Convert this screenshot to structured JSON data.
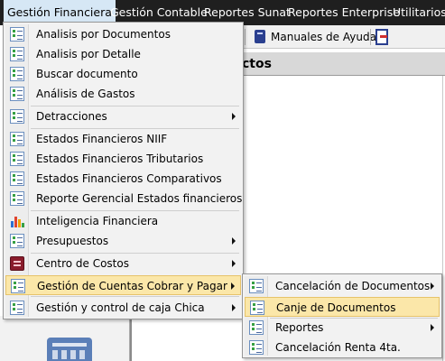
{
  "menubar": {
    "items": [
      "Gestión Financiera",
      "Gestión Contable",
      "Reportes Sunat",
      "Reportes Enterprise",
      "Utilitarios"
    ]
  },
  "toolbar": {
    "manuales_label": "Manuales de Ayuda"
  },
  "panel": {
    "header_fragment": "ctos"
  },
  "main_menu": {
    "items": [
      {
        "label": "Analisis por Documentos",
        "icon": "form-icon",
        "submenu": false
      },
      {
        "label": "Analisis por Detalle",
        "icon": "form-icon",
        "submenu": false
      },
      {
        "label": "Buscar documento",
        "icon": "form-icon",
        "submenu": false
      },
      {
        "label": "Análisis de Gastos",
        "icon": "form-icon",
        "submenu": false
      },
      {
        "label": "Detracciones",
        "icon": "form-icon",
        "submenu": true
      },
      {
        "label": "Estados Financieros NIIF",
        "icon": "form-icon",
        "submenu": false
      },
      {
        "label": "Estados Financieros Tributarios",
        "icon": "form-icon",
        "submenu": false
      },
      {
        "label": "Estados Financieros Comparativos",
        "icon": "form-icon",
        "submenu": false
      },
      {
        "label": "Reporte Gerencial Estados financieros",
        "icon": "form-icon",
        "submenu": false
      },
      {
        "label": "Inteligencia Financiera",
        "icon": "bar-chart-icon",
        "submenu": false
      },
      {
        "label": "Presupuestos",
        "icon": "form-icon",
        "submenu": true
      },
      {
        "label": "Centro de Costos",
        "icon": "costs-icon",
        "submenu": true
      },
      {
        "label": "Gestión de Cuentas Cobrar y Pagar",
        "icon": "form-icon",
        "submenu": true,
        "highlighted": true
      },
      {
        "label": "Gestión y control de caja Chica",
        "icon": "form-icon",
        "submenu": true
      }
    ]
  },
  "sub_menu": {
    "items": [
      {
        "label": "Cancelación de Documentos",
        "icon": "form-icon",
        "submenu": true
      },
      {
        "label": "Canje de Documentos",
        "icon": "form-icon",
        "submenu": false,
        "highlighted": true
      },
      {
        "label": "Reportes",
        "icon": "form-icon",
        "submenu": true
      },
      {
        "label": "Cancelación Renta 4ta.",
        "icon": "form-icon",
        "submenu": false
      }
    ]
  },
  "colors": {
    "menubar_bg": "#1f1f1f",
    "highlight_bg": "#fbe7a9",
    "menu_bg": "#f2f2f2"
  }
}
